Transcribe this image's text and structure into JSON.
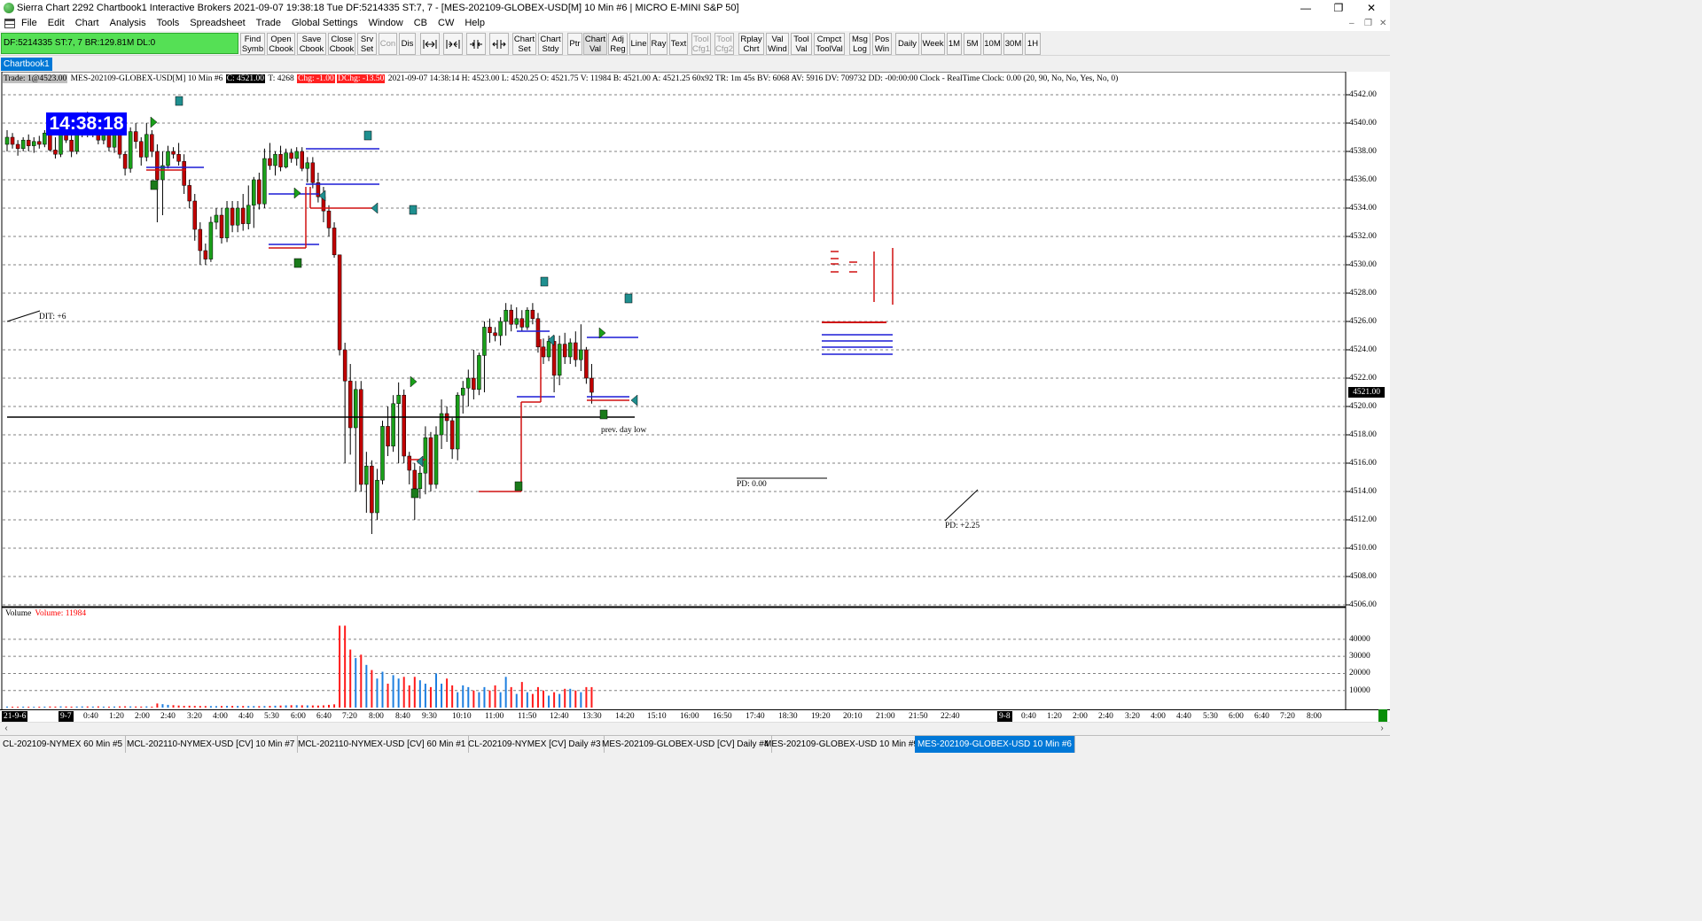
{
  "window": {
    "title": "Sierra Chart 2292 Chartbook1  Interactive Brokers 2021-09-07  19:38:18 Tue  DF:5214335  ST:7, 7 - [MES-202109-GLOBEX-USD[M]  10 Min  #6 | MICRO E-MINI S&P 50]",
    "minimize": "—",
    "restore": "❐",
    "close": "✕"
  },
  "menu": {
    "items": [
      "File",
      "Edit",
      "Chart",
      "Analysis",
      "Tools",
      "Spreadsheet",
      "Trade",
      "Global Settings",
      "Window",
      "CB",
      "CW",
      "Help"
    ],
    "mdi_min": "–",
    "mdi_restore": "❐",
    "mdi_close": "✕"
  },
  "status_box": "DF:5214335  ST:7, 7  BR:129.81M  DL:0",
  "toolbar": {
    "find_symb": "Find\nSymb",
    "open_cbook": "Open\nCbook",
    "save_cbook": "Save\nCbook",
    "close_cbook": "Close\nCbook",
    "srv_set": "Srv\nSet",
    "con": "Con",
    "dis": "Dis",
    "chart_set": "Chart\nSet",
    "chart_stdy": "Chart\nStdy",
    "ptr": "Ptr",
    "chart_val": "Chart\nVal",
    "adj_reg": "Adj\nReg",
    "line": "Line",
    "ray": "Ray",
    "text": "Text",
    "tool_cfg1": "Tool\nCfg1",
    "tool_cfg2": "Tool\nCfg2",
    "rplay_chrt": "Rplay\nChrt",
    "val_wind": "Val\nWind",
    "tool_val": "Tool\nVal",
    "cmpct_toolval": "Cmpct\nToolVal",
    "msg_log": "Msg\nLog",
    "pos_win": "Pos\nWin",
    "daily": "Daily",
    "week": "Week",
    "1m": "1M",
    "5m": "5M",
    "10m": "10M",
    "30m": "30M",
    "1h": "1H"
  },
  "chartbook_tab": "Chartbook1",
  "chart_header": {
    "trade": "Trade: 1@4523.00",
    "symbol": "MES-202109-GLOBEX-USD[M]  10 Min  #6",
    "close": "C: 4521.00",
    "t": "T: 4268",
    "chg": "Chg: -1.00",
    "dchg": "DChg: -13.50",
    "rest": "2021-09-07 14:38:14 H: 4523.00 L: 4520.25 O: 4521.75 V: 11984 B: 4521.00 A: 4521.25 60x92 TR: 1m 45s BV: 6068 AV: 5916 DV: 709732 DD: -00:00:00 Clock - RealTime  Clock: 0.00   (20, 90, No, No, Yes, No, 0)"
  },
  "clock": "14:38:18",
  "price_axis": [
    "4542.00",
    "4540.00",
    "4538.00",
    "4536.00",
    "4534.00",
    "4532.00",
    "4530.00",
    "4528.00",
    "4526.00",
    "4524.00",
    "4522.00",
    "4520.00",
    "4518.00",
    "4516.00",
    "4514.00",
    "4512.00",
    "4510.00",
    "4508.00",
    "4506.00"
  ],
  "current_price": "4521.00",
  "annotations": {
    "dit": "DIT: +6",
    "prev_day_low": "prev. day low",
    "pd1": "PD: 0.00",
    "pd2": "PD: +2.25"
  },
  "volume": {
    "label": "Volume",
    "value": "Volume: 11984",
    "axis": [
      "40000",
      "30000",
      "20000",
      "10000"
    ]
  },
  "time_axis": {
    "start": "21-9-6",
    "day": "9-7",
    "labels": [
      "0:40",
      "1:20",
      "2:00",
      "2:40",
      "3:20",
      "4:00",
      "4:40",
      "5:30",
      "6:00",
      "6:40",
      "7:20",
      "8:00",
      "8:40",
      "9:30",
      "10:10",
      "11:00",
      "11:50",
      "12:40",
      "13:30",
      "14:20",
      "15:10",
      "16:00",
      "16:50",
      "17:40",
      "18:30",
      "19:20",
      "20:10",
      "21:00",
      "21:50",
      "22:40"
    ],
    "day2": "9-8",
    "labels2": [
      "0:40",
      "1:20",
      "2:00",
      "2:40",
      "3:20",
      "4:00",
      "4:40",
      "5:30",
      "6:00",
      "6:40",
      "7:20",
      "8:00"
    ]
  },
  "bottom_tabs": [
    "CL-202109-NYMEX  60 Min  #5",
    "MCL-202110-NYMEX-USD [CV]  10 Min  #7",
    "MCL-202110-NYMEX-USD [CV]  60 Min  #1",
    "CL-202109-NYMEX [CV]  Daily  #3",
    "MES-202109-GLOBEX-USD [CV]  Daily  #4",
    "MES-202109-GLOBEX-USD  10 Min  #9",
    "MES-202109-GLOBEX-USD  10 Min  #6"
  ],
  "chart_data": {
    "type": "candlestick",
    "bar_interval": "10 Min",
    "ylim": [
      4506,
      4543
    ],
    "up_color": "#1aa01a",
    "down_color": "#c00000",
    "candles": [
      [
        4538.5,
        4539.5,
        4538.0,
        4539.0
      ],
      [
        4539.0,
        4539.3,
        4538.2,
        4538.5
      ],
      [
        4538.5,
        4538.8,
        4537.7,
        4538.2
      ],
      [
        4538.2,
        4539.0,
        4538.0,
        4538.8
      ],
      [
        4538.8,
        4539.2,
        4538.0,
        4538.4
      ],
      [
        4538.4,
        4539.0,
        4537.9,
        4538.7
      ],
      [
        4538.7,
        4539.1,
        4538.2,
        4538.5
      ],
      [
        4538.5,
        4539.5,
        4538.3,
        4539.3
      ],
      [
        4539.3,
        4539.8,
        4538.0,
        4538.1
      ],
      [
        4538.1,
        4539.0,
        4537.5,
        4537.8
      ],
      [
        4537.8,
        4540.2,
        4537.6,
        4539.8
      ],
      [
        4539.8,
        4540.3,
        4538.6,
        4538.8
      ],
      [
        4538.8,
        4539.2,
        4537.6,
        4538.0
      ],
      [
        4538.0,
        4539.8,
        4537.8,
        4539.5
      ],
      [
        4539.5,
        4540.5,
        4539.0,
        4540.2
      ],
      [
        4540.2,
        4540.8,
        4539.0,
        4539.3
      ],
      [
        4539.3,
        4540.6,
        4539.0,
        4540.1
      ],
      [
        4540.1,
        4540.6,
        4538.5,
        4538.8
      ],
      [
        4538.8,
        4539.6,
        4538.5,
        4539.3
      ],
      [
        4539.3,
        4539.5,
        4538.0,
        4538.3
      ],
      [
        4538.3,
        4540.0,
        4537.9,
        4539.7
      ],
      [
        4539.7,
        4540.4,
        4537.5,
        4537.8
      ],
      [
        4537.8,
        4538.0,
        4536.3,
        4536.8
      ],
      [
        4536.8,
        4539.7,
        4536.5,
        4539.4
      ],
      [
        4539.4,
        4540.0,
        4538.2,
        4538.7
      ],
      [
        4538.7,
        4539.0,
        4537.0,
        4537.6
      ],
      [
        4537.6,
        4540.0,
        4537.3,
        4539.2
      ],
      [
        4539.2,
        4539.5,
        4537.6,
        4538.0
      ],
      [
        4538.0,
        4538.5,
        4533.0,
        4536.0
      ],
      [
        4536.0,
        4538.0,
        4533.5,
        4537.0
      ],
      [
        4537.0,
        4538.4,
        4536.8,
        4538.0
      ],
      [
        4538.0,
        4538.3,
        4537.5,
        4537.8
      ],
      [
        4537.8,
        4538.6,
        4537.0,
        4537.3
      ],
      [
        4537.3,
        4537.8,
        4535.0,
        4535.6
      ],
      [
        4535.6,
        4536.0,
        4534.0,
        4534.5
      ],
      [
        4534.5,
        4535.0,
        4531.7,
        4532.5
      ],
      [
        4532.5,
        4533.0,
        4530.0,
        4531.0
      ],
      [
        4531.0,
        4531.5,
        4530.0,
        4530.4
      ],
      [
        4530.4,
        4533.4,
        4530.2,
        4533.0
      ],
      [
        4533.0,
        4534.0,
        4532.5,
        4533.5
      ],
      [
        4533.5,
        4534.0,
        4531.5,
        4531.9
      ],
      [
        4531.9,
        4534.5,
        4531.6,
        4534.0
      ],
      [
        4534.0,
        4534.5,
        4532.3,
        4532.8
      ],
      [
        4532.8,
        4534.5,
        4532.3,
        4534.0
      ],
      [
        4534.0,
        4535.0,
        4532.4,
        4532.9
      ],
      [
        4532.9,
        4535.6,
        4532.5,
        4534.2
      ],
      [
        4534.2,
        4536.2,
        4532.6,
        4536.0
      ],
      [
        4536.0,
        4536.5,
        4533.9,
        4534.3
      ],
      [
        4534.3,
        4538.2,
        4534.0,
        4537.5
      ],
      [
        4537.5,
        4538.6,
        4536.7,
        4537.0
      ],
      [
        4537.0,
        4538.0,
        4536.3,
        4537.8
      ],
      [
        4537.8,
        4538.4,
        4536.6,
        4536.9
      ],
      [
        4536.9,
        4538.2,
        4536.8,
        4537.9
      ],
      [
        4537.9,
        4538.2,
        4537.2,
        4537.5
      ],
      [
        4537.5,
        4538.3,
        4537.0,
        4538.0
      ],
      [
        4538.0,
        4538.3,
        4536.6,
        4536.8
      ],
      [
        4536.8,
        4537.6,
        4535.8,
        4537.2
      ],
      [
        4537.2,
        4537.6,
        4535.4,
        4535.8
      ],
      [
        4535.8,
        4536.5,
        4534.4,
        4534.8
      ],
      [
        4534.8,
        4535.5,
        4533.0,
        4533.8
      ],
      [
        4533.8,
        4534.2,
        4532.0,
        4532.6
      ],
      [
        4532.6,
        4533.0,
        4530.5,
        4530.7
      ],
      [
        4530.7,
        4530.7,
        4523.6,
        4524.0
      ],
      [
        4524.0,
        4524.5,
        4516.0,
        4521.8
      ],
      [
        4521.8,
        4523.0,
        4516.6,
        4518.5
      ],
      [
        4518.5,
        4521.8,
        4514.0,
        4521.2
      ],
      [
        4521.2,
        4521.8,
        4514.0,
        4514.5
      ],
      [
        4514.5,
        4516.8,
        4512.5,
        4515.8
      ],
      [
        4515.8,
        4516.2,
        4511.0,
        4512.5
      ],
      [
        4512.5,
        4515.6,
        4512.0,
        4514.8
      ],
      [
        4514.8,
        4519.0,
        4514.5,
        4518.6
      ],
      [
        4518.6,
        4520.0,
        4516.5,
        4517.2
      ],
      [
        4517.2,
        4520.8,
        4516.8,
        4520.2
      ],
      [
        4520.2,
        4521.7,
        4516.0,
        4520.8
      ],
      [
        4520.8,
        4521.2,
        4516.0,
        4516.5
      ],
      [
        4516.5,
        4516.8,
        4514.5,
        4515.5
      ],
      [
        4515.5,
        4516.0,
        4512.0,
        4514.2
      ],
      [
        4514.2,
        4515.8,
        4513.5,
        4515.3
      ],
      [
        4515.3,
        4518.6,
        4513.8,
        4517.8
      ],
      [
        4517.8,
        4518.2,
        4514.0,
        4514.5
      ],
      [
        4514.5,
        4518.6,
        4514.2,
        4518.0
      ],
      [
        4518.0,
        4520.5,
        4517.0,
        4519.5
      ],
      [
        4519.5,
        4520.0,
        4517.5,
        4519.0
      ],
      [
        4519.0,
        4519.2,
        4516.3,
        4517.0
      ],
      [
        4517.0,
        4521.0,
        4516.2,
        4520.8
      ],
      [
        4520.8,
        4521.8,
        4519.5,
        4521.3
      ],
      [
        4521.3,
        4522.6,
        4520.0,
        4522.0
      ],
      [
        4522.0,
        4524.0,
        4520.5,
        4521.2
      ],
      [
        4521.2,
        4523.8,
        4520.8,
        4523.6
      ],
      [
        4523.6,
        4526.0,
        4521.0,
        4525.6
      ],
      [
        4525.6,
        4526.2,
        4524.5,
        4525.2
      ],
      [
        4525.2,
        4525.6,
        4524.6,
        4525.0
      ],
      [
        4525.0,
        4526.3,
        4524.3,
        4526.0
      ],
      [
        4526.0,
        4527.3,
        4525.0,
        4526.8
      ],
      [
        4526.8,
        4527.2,
        4525.3,
        4525.8
      ],
      [
        4525.8,
        4527.0,
        4525.5,
        4526.2
      ],
      [
        4526.2,
        4526.8,
        4525.3,
        4525.6
      ],
      [
        4525.6,
        4527.0,
        4525.4,
        4526.8
      ],
      [
        4526.8,
        4527.3,
        4525.8,
        4526.2
      ],
      [
        4526.2,
        4526.6,
        4523.8,
        4524.2
      ],
      [
        4524.2,
        4524.8,
        4523.0,
        4523.5
      ],
      [
        4523.5,
        4525.0,
        4523.2,
        4524.6
      ],
      [
        4524.6,
        4525.0,
        4521.0,
        4522.2
      ],
      [
        4522.2,
        4525.0,
        4521.5,
        4524.4
      ],
      [
        4524.4,
        4525.2,
        4523.0,
        4523.5
      ],
      [
        4523.5,
        4524.8,
        4523.0,
        4524.5
      ],
      [
        4524.5,
        4525.3,
        4522.8,
        4523.3
      ],
      [
        4523.3,
        4525.8,
        4522.5,
        4524.0
      ],
      [
        4524.0,
        4524.2,
        4521.6,
        4522.0
      ],
      [
        4522.0,
        4523.0,
        4520.2,
        4521.0
      ]
    ],
    "volume": [
      600,
      520,
      480,
      560,
      500,
      470,
      510,
      560,
      640,
      590,
      700,
      640,
      560,
      620,
      680,
      660,
      600,
      700,
      560,
      540,
      620,
      700,
      760,
      680,
      640,
      600,
      700,
      560,
      2400,
      2000,
      1600,
      1400,
      1200,
      1000,
      1100,
      980,
      940,
      900,
      880,
      860,
      920,
      1000,
      980,
      960,
      940,
      900,
      880,
      860,
      900,
      1000,
      1100,
      1200,
      1300,
      1400,
      1400,
      1350,
      1300,
      1250,
      1200,
      1300,
      1600,
      1900,
      48000,
      48000,
      34000,
      29000,
      31000,
      25000,
      22000,
      17000,
      21000,
      14000,
      19000,
      17000,
      18000,
      13000,
      18000,
      16000,
      14000,
      12000,
      20000,
      14000,
      17000,
      13000,
      9000,
      13000,
      12000,
      10000,
      9000,
      12000,
      10000,
      13000,
      9000,
      18000,
      12000,
      8000,
      15000,
      9000,
      8000,
      12000,
      10000,
      7000,
      9000,
      8000,
      11000,
      11000,
      10000,
      9000,
      12000,
      11984
    ]
  }
}
